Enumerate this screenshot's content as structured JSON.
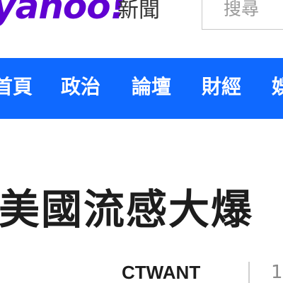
{
  "header": {
    "logo": "yahoo!",
    "logo_sub": "新聞",
    "search": {
      "placeholder": "搜尋"
    }
  },
  "nav": {
    "items": [
      {
        "label": "首頁"
      },
      {
        "label": "政治"
      },
      {
        "label": "論壇"
      },
      {
        "label": "財經"
      },
      {
        "label": "娛"
      }
    ],
    "background": "#0f69ff"
  },
  "article": {
    "headline": "美國流感大爆",
    "source": "CTWANT",
    "date": "1"
  },
  "colors": {
    "brand": "#6001d2",
    "nav": "#0f69ff",
    "text": "#1d1d1d"
  }
}
